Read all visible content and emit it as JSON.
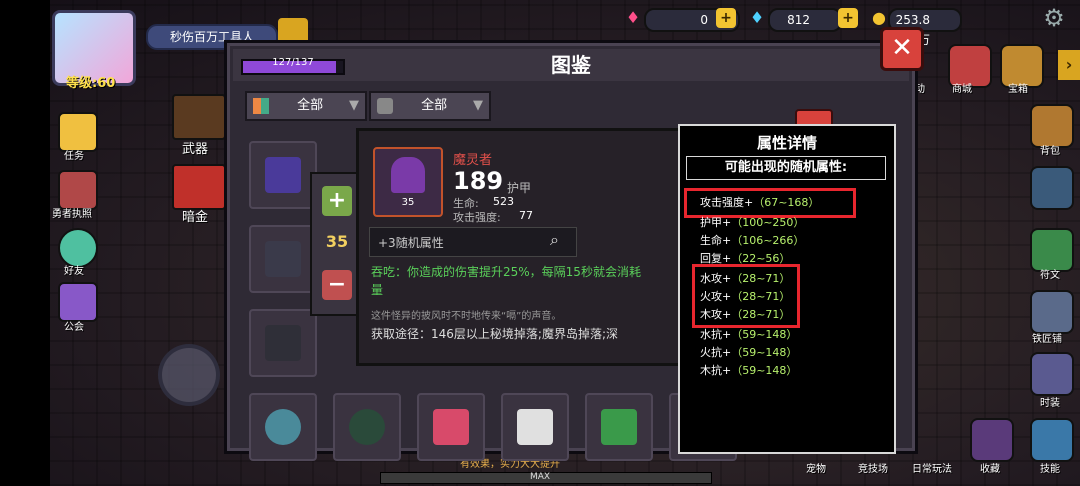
{
  "player": {
    "level": "等级:60",
    "title": "秒伤百万工具人"
  },
  "resources": {
    "hearts": "0",
    "diamonds": "812",
    "gold": "253.8万"
  },
  "left_menu": [
    {
      "label": "任务",
      "icon": "task-icon"
    },
    {
      "label": "勇者执照",
      "icon": "license-icon"
    },
    {
      "label": "好友",
      "icon": "friend-icon"
    },
    {
      "label": "公会",
      "icon": "guild-icon"
    }
  ],
  "category_buttons": [
    {
      "label": "武器",
      "icon": "weapon-icon"
    },
    {
      "label": "暗金",
      "icon": "dark-gold-icon"
    }
  ],
  "right_menu": [
    {
      "label": "活动"
    },
    {
      "label": "商城"
    },
    {
      "label": "宝箱"
    },
    {
      "label": "背包"
    },
    {
      "label": "符文"
    },
    {
      "label": "铁匠铺"
    },
    {
      "label": "时装"
    },
    {
      "label": "技能"
    }
  ],
  "bottom_tabs": [
    "宠物",
    "竞技场",
    "日常玩法",
    "收藏"
  ],
  "dialog": {
    "title": "图鉴",
    "progress_text": "127/137",
    "progress_fraction": 0.927,
    "close_label": "✕",
    "filter1": "全部",
    "filter2": "全部"
  },
  "detail": {
    "name": "魔灵者",
    "number": "189",
    "type": "护甲",
    "count": "35",
    "life_label": "生命:",
    "life_value": "523",
    "atk_label": "攻击强度:",
    "atk_value": "77",
    "random_attr": "+3随机属性",
    "effect": "吞吃：你造成的伤害提升25%，每隔15秒就会消耗",
    "effect2": "量",
    "lore": "这件怪异的披风时不时地传来“嗝”的声音。",
    "source": "获取途径：146层以上秘境掉落;魔界岛掉落;深"
  },
  "quantity": {
    "value": "35",
    "plus": "+",
    "minus": "−"
  },
  "attr_panel": {
    "title": "属性详情",
    "subtitle": "可能出现的随机属性:",
    "lines": [
      {
        "name": "攻击强度+",
        "range": "（67~168）"
      },
      {
        "name": "护甲+",
        "range": "（100~250）"
      },
      {
        "name": "生命+",
        "range": "（106~266）"
      },
      {
        "name": "回复+",
        "range": "（22~56）"
      },
      {
        "name": "水攻+",
        "range": "（28~71）"
      },
      {
        "name": "火攻+",
        "range": "（28~71）"
      },
      {
        "name": "木攻+",
        "range": "（28~71）"
      },
      {
        "name": "水抗+",
        "range": "（59~148）"
      },
      {
        "name": "火抗+",
        "range": "（59~148）"
      },
      {
        "name": "木抗+",
        "range": "（59~148）"
      }
    ]
  },
  "toast": "有效果，实力大大提升",
  "max_label": "MAX"
}
